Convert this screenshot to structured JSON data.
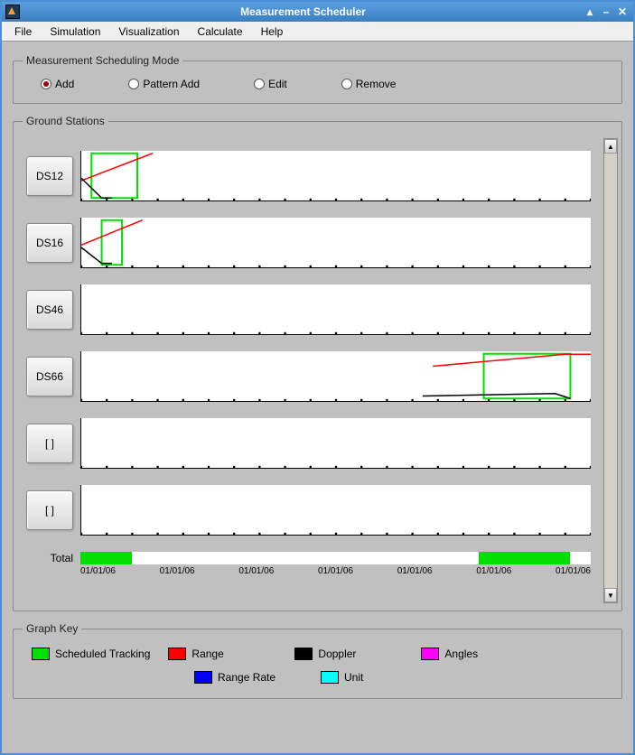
{
  "window": {
    "title": "Measurement Scheduler"
  },
  "menu": {
    "file": "File",
    "simulation": "Simulation",
    "visualization": "Visualization",
    "calculate": "Calculate",
    "help": "Help"
  },
  "mode_group": {
    "legend": "Measurement Scheduling Mode",
    "options": {
      "add": "Add",
      "pattern_add": "Pattern Add",
      "edit": "Edit",
      "remove": "Remove"
    },
    "selected": "add"
  },
  "stations_group": {
    "legend": "Ground Stations",
    "stations": [
      {
        "label": "DS12"
      },
      {
        "label": "DS16"
      },
      {
        "label": "DS46"
      },
      {
        "label": "DS66"
      },
      {
        "label": "[ ]"
      },
      {
        "label": "[ ]"
      }
    ]
  },
  "total": {
    "label": "Total",
    "axis_dates": [
      "01/01/06",
      "01/01/06",
      "01/01/06",
      "01/01/06",
      "01/01/06",
      "01/01/06",
      "01/01/06"
    ]
  },
  "key": {
    "legend": "Graph Key",
    "items": {
      "scheduled": {
        "label": "Scheduled Tracking",
        "color": "#00e000"
      },
      "range": {
        "label": "Range",
        "color": "#ff0000"
      },
      "doppler": {
        "label": "Doppler",
        "color": "#000000"
      },
      "angles": {
        "label": "Angles",
        "color": "#ff00ff"
      },
      "range_rate": {
        "label": "Range Rate",
        "color": "#0000ff"
      },
      "unit": {
        "label": "Unit",
        "color": "#00ffff"
      }
    }
  },
  "chart_data": [
    {
      "type": "line",
      "station": "DS12",
      "scheduled_window": [
        2,
        11
      ],
      "series": [
        {
          "name": "Range",
          "color": "#ff0000",
          "points": [
            [
              0,
              60
            ],
            [
              14,
              5
            ]
          ]
        },
        {
          "name": "Doppler",
          "color": "#000000",
          "points": [
            [
              0,
              55
            ],
            [
              4,
              95
            ],
            [
              6,
              95
            ]
          ]
        }
      ],
      "xlim": [
        0,
        100
      ],
      "ylim": [
        0,
        100
      ]
    },
    {
      "type": "line",
      "station": "DS16",
      "scheduled_window": [
        4,
        8
      ],
      "series": [
        {
          "name": "Range",
          "color": "#ff0000",
          "points": [
            [
              0,
              55
            ],
            [
              12,
              5
            ]
          ]
        },
        {
          "name": "Doppler",
          "color": "#000000",
          "points": [
            [
              0,
              60
            ],
            [
              4,
              92
            ],
            [
              6,
              92
            ]
          ]
        }
      ],
      "xlim": [
        0,
        100
      ],
      "ylim": [
        0,
        100
      ]
    },
    {
      "type": "line",
      "station": "DS46",
      "scheduled_window": null,
      "series": [],
      "xlim": [
        0,
        100
      ],
      "ylim": [
        0,
        100
      ]
    },
    {
      "type": "line",
      "station": "DS66",
      "scheduled_window": [
        79,
        96
      ],
      "series": [
        {
          "name": "Range",
          "color": "#ff0000",
          "points": [
            [
              69,
              30
            ],
            [
              95,
              6
            ],
            [
              100,
              6
            ]
          ]
        },
        {
          "name": "Doppler",
          "color": "#000000",
          "points": [
            [
              67,
              90
            ],
            [
              93,
              85
            ],
            [
              96,
              95
            ]
          ]
        }
      ],
      "xlim": [
        0,
        100
      ],
      "ylim": [
        0,
        100
      ]
    },
    {
      "type": "line",
      "station": "[ ]",
      "scheduled_window": null,
      "series": [],
      "xlim": [
        0,
        100
      ],
      "ylim": [
        0,
        100
      ]
    },
    {
      "type": "line",
      "station": "[ ]",
      "scheduled_window": null,
      "series": [],
      "xlim": [
        0,
        100
      ],
      "ylim": [
        0,
        100
      ]
    }
  ],
  "total_chart": {
    "type": "bar",
    "fills": [
      {
        "start": 0,
        "end": 10
      },
      {
        "start": 78,
        "end": 96
      }
    ],
    "xlim": [
      0,
      100
    ]
  }
}
